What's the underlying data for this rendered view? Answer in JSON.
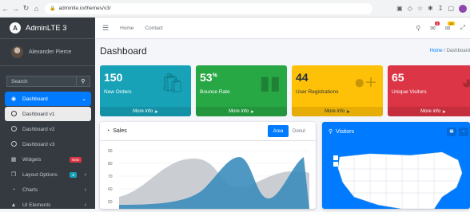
{
  "browser": {
    "url": "adminlte.io/themes/v3/"
  },
  "sidebar": {
    "brand": "AdminLTE 3",
    "user": "Alexander Pierce",
    "search_placeholder": "Search",
    "items": [
      {
        "label": "Dashboard",
        "icon": "dashboard-icon"
      },
      {
        "label": "Dashboard v1",
        "icon": "circle-icon"
      },
      {
        "label": "Dashboard v2",
        "icon": "circle-icon"
      },
      {
        "label": "Dashboard v3",
        "icon": "circle-icon"
      },
      {
        "label": "Widgets",
        "icon": "grid-icon",
        "badge": "New"
      },
      {
        "label": "Layout Options",
        "icon": "copy-icon",
        "badge": "6"
      },
      {
        "label": "Charts",
        "icon": "pie-chart-icon"
      },
      {
        "label": "UI Elements",
        "icon": "tree-icon"
      }
    ]
  },
  "topnav": {
    "links": [
      "Home",
      "Contact"
    ],
    "messages_badge": "3",
    "notifications_badge": "15"
  },
  "header": {
    "title": "Dashboard",
    "breadcrumb_home": "Home",
    "breadcrumb_current": "Dashboard"
  },
  "stats": [
    {
      "value": "150",
      "sup": "",
      "label": "New Orders",
      "footer": "More info",
      "color": "#17a2b8",
      "icon": "shopping-bag-icon"
    },
    {
      "value": "53",
      "sup": "%",
      "label": "Bounce Rate",
      "footer": "More info",
      "color": "#28a745",
      "icon": "bar-chart-icon"
    },
    {
      "value": "44",
      "sup": "",
      "label": "User Registrations",
      "footer": "More info",
      "color": "#ffc107",
      "icon": "user-plus-icon"
    },
    {
      "value": "65",
      "sup": "",
      "label": "Unique Visitors",
      "footer": "More info",
      "color": "#dc3545",
      "icon": "pie-chart-icon"
    }
  ],
  "sales": {
    "title": "Sales",
    "tab_area": "Area",
    "tab_donut": "Donut",
    "y_ticks": [
      "90",
      "80",
      "70",
      "60",
      "50"
    ]
  },
  "visitors": {
    "title": "Visitors"
  }
}
